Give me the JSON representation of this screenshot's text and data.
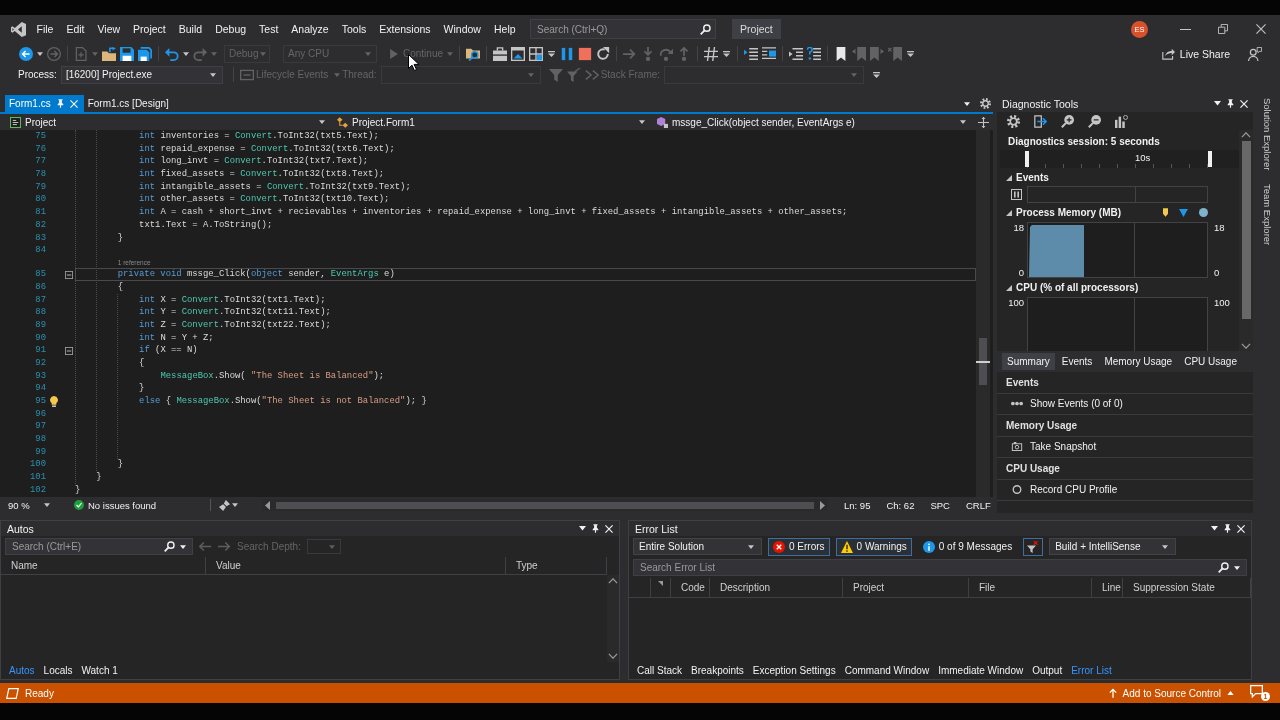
{
  "menu_bar": {
    "items": [
      "File",
      "Edit",
      "View",
      "Project",
      "Build",
      "Debug",
      "Test",
      "Analyze",
      "Tools",
      "Extensions",
      "Window",
      "Help"
    ],
    "search": {
      "placeholder": "Search (Ctrl+Q)"
    },
    "solution_name": "Project",
    "account_initials": "ES"
  },
  "toolbar": [
    {
      "kind": "back",
      "disabled": false
    },
    {
      "kind": "caret",
      "disabled": false
    },
    {
      "kind": "forward",
      "disabled": true
    },
    {
      "kind": "separator"
    },
    {
      "kind": "new",
      "disabled": true
    },
    {
      "kind": "caret",
      "disabled": true
    },
    {
      "kind": "open",
      "disabled": false
    },
    {
      "kind": "save",
      "disabled": false
    },
    {
      "kind": "save_all",
      "disabled": false
    },
    {
      "kind": "separator"
    },
    {
      "kind": "undo",
      "disabled": false
    },
    {
      "kind": "caret",
      "disabled": false
    },
    {
      "kind": "redo",
      "disabled": true
    },
    {
      "kind": "caret",
      "disabled": true
    },
    {
      "kind": "dropdown",
      "label": "Debug",
      "disabled": true
    },
    {
      "kind": "dropdown",
      "label": "Any CPU",
      "disabled": true
    },
    {
      "kind": "continue",
      "label": "Continue",
      "disabled": true
    },
    {
      "kind": "caret",
      "disabled": true
    },
    {
      "kind": "separator"
    },
    {
      "kind": "find",
      "disabled": false
    },
    {
      "kind": "separator"
    },
    {
      "kind": "toolbox",
      "disabled": false
    },
    {
      "kind": "window",
      "disabled": false
    },
    {
      "kind": "grid",
      "disabled": false
    },
    {
      "kind": "overflow",
      "disabled": false
    },
    {
      "kind": "pause",
      "disabled": false
    },
    {
      "kind": "stop",
      "disabled": false
    },
    {
      "kind": "restart",
      "disabled": false
    },
    {
      "kind": "separator"
    },
    {
      "kind": "next",
      "disabled": true
    },
    {
      "kind": "step_into",
      "disabled": true
    },
    {
      "kind": "step_over",
      "disabled": true
    },
    {
      "kind": "step_out",
      "disabled": true
    },
    {
      "kind": "separator"
    },
    {
      "kind": "hash",
      "disabled": false
    },
    {
      "kind": "overflow",
      "disabled": false
    },
    {
      "kind": "separator"
    },
    {
      "kind": "list",
      "disabled": false
    },
    {
      "kind": "list_alt",
      "disabled": false
    },
    {
      "kind": "separator"
    },
    {
      "kind": "indent",
      "disabled": false
    },
    {
      "kind": "lines",
      "disabled": false
    },
    {
      "kind": "separator"
    },
    {
      "kind": "bookmark",
      "disabled": false
    },
    {
      "kind": "bookmark_prev",
      "disabled": true
    },
    {
      "kind": "bookmark_next",
      "disabled": true
    },
    {
      "kind": "bookmark_clear",
      "disabled": true
    },
    {
      "kind": "overflow",
      "disabled": false
    }
  ],
  "live_share": "Live Share",
  "debug_location": {
    "process_label": "Process:",
    "process": "[16200] Project.exe",
    "lifecycle": {
      "label": "Lifecycle Events",
      "disabled": true
    },
    "thread": {
      "label": "Thread:",
      "disabled": true
    },
    "filters": [
      {
        "kind": "filter",
        "disabled": true
      },
      {
        "kind": "filter_alt",
        "disabled": true
      },
      {
        "kind": "threads",
        "disabled": true
      }
    ],
    "stack_frame": {
      "label": "Stack Frame:",
      "disabled": true
    }
  },
  "editor": {
    "tabs": [
      {
        "label": "Form1.cs",
        "selected": true
      },
      {
        "label": "Form1.cs [Design]",
        "selected": false
      }
    ],
    "navigation": [
      "Project",
      "Project.Form1",
      "mssge_Click(object sender, EventArgs e)"
    ],
    "lines": [
      {
        "number": "75",
        "highlighted": false,
        "tokens": [
          {
            "kind": "keyword",
            "text": "            int"
          },
          {
            "kind": "plain",
            "text": " inventories = "
          },
          {
            "kind": "type",
            "text": "Convert"
          },
          {
            "kind": "plain",
            "text": ".ToInt32(txt5.Text);"
          }
        ]
      },
      {
        "number": "76",
        "highlighted": false,
        "tokens": [
          {
            "kind": "keyword",
            "text": "            int"
          },
          {
            "kind": "plain",
            "text": " repaid_expense = "
          },
          {
            "kind": "type",
            "text": "Convert"
          },
          {
            "kind": "plain",
            "text": ".ToInt32(txt6.Text);"
          }
        ]
      },
      {
        "number": "77",
        "highlighted": false,
        "tokens": [
          {
            "kind": "keyword",
            "text": "            int"
          },
          {
            "kind": "plain",
            "text": " long_invt = "
          },
          {
            "kind": "type",
            "text": "Convert"
          },
          {
            "kind": "plain",
            "text": ".ToInt32(txt7.Text);"
          }
        ]
      },
      {
        "number": "78",
        "highlighted": false,
        "tokens": [
          {
            "kind": "keyword",
            "text": "            int"
          },
          {
            "kind": "plain",
            "text": " fixed_assets = "
          },
          {
            "kind": "type",
            "text": "Convert"
          },
          {
            "kind": "plain",
            "text": ".ToInt32(txt8.Text);"
          }
        ]
      },
      {
        "number": "79",
        "highlighted": false,
        "tokens": [
          {
            "kind": "keyword",
            "text": "            int"
          },
          {
            "kind": "plain",
            "text": " intangible_assets = "
          },
          {
            "kind": "type",
            "text": "Convert"
          },
          {
            "kind": "plain",
            "text": ".ToInt32(txt9.Text);"
          }
        ]
      },
      {
        "number": "80",
        "highlighted": false,
        "tokens": [
          {
            "kind": "keyword",
            "text": "            int"
          },
          {
            "kind": "plain",
            "text": " other_assets = "
          },
          {
            "kind": "type",
            "text": "Convert"
          },
          {
            "kind": "plain",
            "text": ".ToInt32(txt10.Text);"
          }
        ]
      },
      {
        "number": "81",
        "highlighted": false,
        "tokens": [
          {
            "kind": "keyword",
            "text": "            int"
          },
          {
            "kind": "plain",
            "text": " A = cash + short_invt + recievables + inventories + repaid_expense + long_invt + fixed_assets + intangible_assets + other_assets;"
          }
        ]
      },
      {
        "number": "82",
        "highlighted": false,
        "tokens": [
          {
            "kind": "plain",
            "text": "            txt1.Text = A.ToString();"
          }
        ]
      },
      {
        "number": "83",
        "highlighted": false,
        "tokens": [
          {
            "kind": "plain",
            "text": "        }"
          }
        ]
      },
      {
        "number": "84",
        "highlighted": false
      },
      {
        "number": "85",
        "highlighted": true,
        "lens": "1 reference",
        "fold": {
          "expanded": true
        },
        "tokens": [
          {
            "kind": "keyword",
            "text": "        private void"
          },
          {
            "kind": "plain",
            "text": " mssge_Click("
          },
          {
            "kind": "keyword",
            "text": "object"
          },
          {
            "kind": "plain",
            "text": " sender, "
          },
          {
            "kind": "type",
            "text": "EventArgs"
          },
          {
            "kind": "plain",
            "text": " e)"
          }
        ]
      },
      {
        "number": "86",
        "highlighted": false,
        "tokens": [
          {
            "kind": "plain",
            "text": "        {"
          }
        ]
      },
      {
        "number": "87",
        "highlighted": false,
        "tokens": [
          {
            "kind": "keyword",
            "text": "            int"
          },
          {
            "kind": "plain",
            "text": " X = "
          },
          {
            "kind": "type",
            "text": "Convert"
          },
          {
            "kind": "plain",
            "text": ".ToInt32(txt1.Text);"
          }
        ]
      },
      {
        "number": "88",
        "highlighted": false,
        "tokens": [
          {
            "kind": "keyword",
            "text": "            int"
          },
          {
            "kind": "plain",
            "text": " Y = "
          },
          {
            "kind": "type",
            "text": "Convert"
          },
          {
            "kind": "plain",
            "text": ".ToInt32(txt11.Text);"
          }
        ]
      },
      {
        "number": "89",
        "highlighted": false,
        "tokens": [
          {
            "kind": "keyword",
            "text": "            int"
          },
          {
            "kind": "plain",
            "text": " Z = "
          },
          {
            "kind": "type",
            "text": "Convert"
          },
          {
            "kind": "plain",
            "text": ".ToInt32(txt22.Text);"
          }
        ]
      },
      {
        "number": "90",
        "highlighted": false,
        "tokens": [
          {
            "kind": "keyword",
            "text": "            int"
          },
          {
            "kind": "plain",
            "text": " N = Y + Z;"
          }
        ]
      },
      {
        "number": "91",
        "highlighted": false,
        "fold": {
          "expanded": true
        },
        "tokens": [
          {
            "kind": "keyword",
            "text": "            if"
          },
          {
            "kind": "plain",
            "text": " (X == N)"
          }
        ]
      },
      {
        "number": "92",
        "highlighted": false,
        "tokens": [
          {
            "kind": "plain",
            "text": "            {"
          }
        ]
      },
      {
        "number": "93",
        "highlighted": false,
        "tokens": [
          {
            "kind": "type",
            "text": "                MessageBox"
          },
          {
            "kind": "plain",
            "text": ".Show( "
          },
          {
            "kind": "string",
            "text": "\"The Sheet is Balanced\""
          },
          {
            "kind": "plain",
            "text": ");"
          }
        ]
      },
      {
        "number": "94",
        "highlighted": false,
        "tokens": [
          {
            "kind": "plain",
            "text": "            }"
          }
        ]
      },
      {
        "number": "95",
        "highlighted": false,
        "quick_action": true,
        "tokens": [
          {
            "kind": "keyword",
            "text": "            else"
          },
          {
            "kind": "plain",
            "text": " { "
          },
          {
            "kind": "type",
            "text": "MessageBox"
          },
          {
            "kind": "plain",
            "text": ".Show("
          },
          {
            "kind": "string",
            "text": "\"The Sheet is not Balanced\""
          },
          {
            "kind": "plain",
            "text": "); }"
          }
        ]
      },
      {
        "number": "96",
        "highlighted": false
      },
      {
        "number": "97",
        "highlighted": false
      },
      {
        "number": "98",
        "highlighted": false
      },
      {
        "number": "99",
        "highlighted": false
      },
      {
        "number": "100",
        "highlighted": false,
        "tokens": [
          {
            "kind": "plain",
            "text": "        }"
          }
        ]
      },
      {
        "number": "101",
        "highlighted": false,
        "tokens": [
          {
            "kind": "plain",
            "text": "    }"
          }
        ]
      },
      {
        "number": "102",
        "highlighted": false,
        "tokens": [
          {
            "kind": "plain",
            "text": "}"
          }
        ]
      }
    ],
    "status": {
      "zoom": "90 %",
      "issues": "No issues found",
      "line": "Ln: 95",
      "column": "Ch: 62",
      "indentation": "SPC",
      "line_endings": "CRLF"
    }
  },
  "diagnostic_tools": {
    "title": "Diagnostic Tools",
    "session": "Diagnostics session: 5 seconds",
    "ruler_label": "10s",
    "graphs": [
      {
        "kind": "events",
        "label": "Events",
        "expanded": true
      },
      {
        "kind": "memory",
        "label": "Process Memory (MB)",
        "expanded": true,
        "left_axis": [
          "18",
          "0"
        ],
        "right_axis": [
          "18",
          "0"
        ]
      },
      {
        "kind": "cpu",
        "label": "CPU (% of all processors)",
        "expanded": true,
        "left_axis": [
          "100"
        ],
        "right_axis": [
          "100"
        ]
      }
    ],
    "tabs": [
      {
        "label": "Summary",
        "selected": true
      },
      {
        "label": "Events",
        "selected": false
      },
      {
        "label": "Memory Usage",
        "selected": false
      },
      {
        "label": "CPU Usage",
        "selected": false
      }
    ],
    "summary": [
      {
        "kind": "events",
        "heading": "Events",
        "action": "Show Events (0 of 0)"
      },
      {
        "kind": "snapshot",
        "heading": "Memory Usage",
        "action": "Take Snapshot"
      },
      {
        "kind": "profile",
        "heading": "CPU Usage",
        "action": "Record CPU Profile"
      }
    ]
  },
  "side_tabs": [
    "Solution Explorer",
    "Team Explorer"
  ],
  "autos": {
    "title": "Autos",
    "search": {
      "placeholder": "Search (Ctrl+E)"
    },
    "history": [
      {
        "kind": "left",
        "disabled": true
      },
      {
        "kind": "right",
        "disabled": true
      }
    ],
    "search_depth": {
      "label": "Search Depth:",
      "disabled": true
    },
    "columns": [
      "Name",
      "Value",
      "Type"
    ],
    "tabs": [
      {
        "label": "Autos",
        "selected": true
      },
      {
        "label": "Locals",
        "selected": false
      },
      {
        "label": "Watch 1",
        "selected": false
      }
    ]
  },
  "error_list": {
    "title": "Error List",
    "scope": "Entire Solution",
    "filters": [
      {
        "kind": "error",
        "label": "0 Errors",
        "selected": true
      },
      {
        "kind": "warning",
        "label": "0 Warnings",
        "selected": true
      },
      {
        "kind": "message",
        "label": "0 of 9 Messages",
        "selected": false
      }
    ],
    "filter_toggle": {
      "selected": true
    },
    "build_filter": "Build + IntelliSense",
    "search": {
      "placeholder": "Search Error List"
    },
    "columns": [
      "Code",
      "Description",
      "Project",
      "File",
      "Line",
      "Suppression State"
    ],
    "tabs": [
      {
        "label": "Call Stack",
        "selected": false
      },
      {
        "label": "Breakpoints",
        "selected": false
      },
      {
        "label": "Exception Settings",
        "selected": false
      },
      {
        "label": "Command Window",
        "selected": false
      },
      {
        "label": "Immediate Window",
        "selected": false
      },
      {
        "label": "Output",
        "selected": false
      },
      {
        "label": "Error List",
        "selected": true
      }
    ]
  },
  "status_bar": {
    "message": "Ready",
    "source_control": "Add to Source Control",
    "notification_count": "1"
  }
}
